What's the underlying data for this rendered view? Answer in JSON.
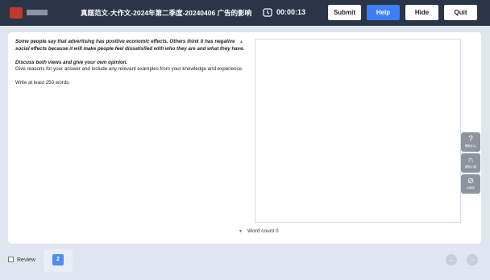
{
  "header": {
    "title": "真题范文-大作文-2024年第二季度-20240406 广告的影响",
    "timer": "00:00:13",
    "buttons": {
      "submit": "Submit",
      "help": "Help",
      "hide": "Hide",
      "quit": "Quit"
    }
  },
  "question": {
    "prompt_line1": "Some people say that advertising has positive economic effects. Others think it has negative social effects because it will make people feel dissatisfied with who they are and what they have.",
    "task": "Discuss both views and give your own opinion.",
    "instruction": "Give reasons for your answer and include any relevant examples from your knowledge and experience.",
    "word_limit": "Write at least 250 words."
  },
  "answer": {
    "word_count_label": "Word count",
    "word_count_value": "0"
  },
  "side_tools": [
    {
      "label": "帮助中心",
      "icon": "help-circle-icon"
    },
    {
      "label": "联系小助",
      "icon": "headset-icon"
    },
    {
      "label": "小助手",
      "icon": "compass-icon"
    }
  ],
  "footer": {
    "review_label": "Review",
    "page_number": "2"
  },
  "colors": {
    "topbar": "#2a3547",
    "accent": "#3d7ef7"
  }
}
